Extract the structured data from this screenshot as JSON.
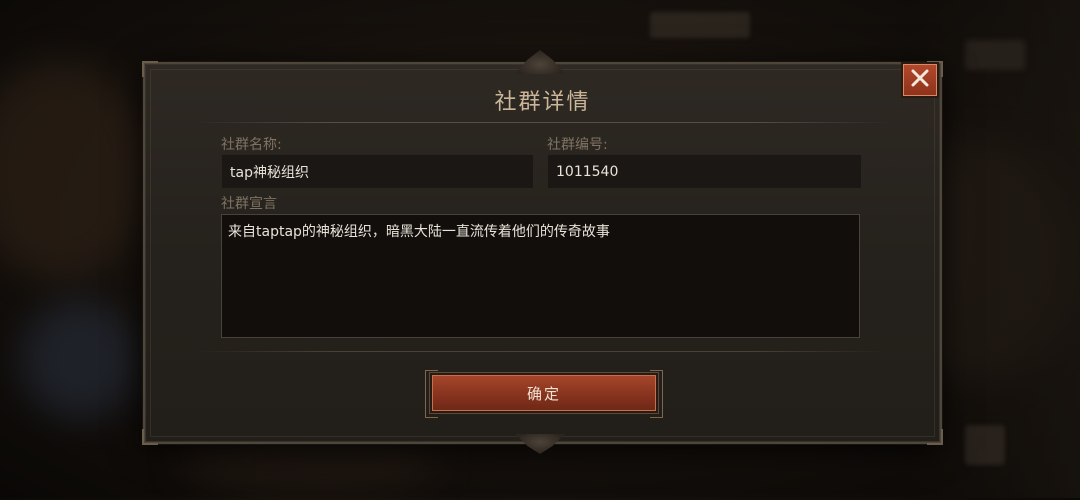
{
  "dialog": {
    "title": "社群详情",
    "name_label": "社群名称:",
    "name_value": "tap神秘组织",
    "id_label": "社群编号:",
    "id_value": "1011540",
    "declaration_label": "社群宣言",
    "declaration_text": "来自taptap的神秘组织，暗黑大陆一直流传着他们的传奇故事",
    "confirm_label": "确定"
  },
  "icons": {
    "close": "close-icon"
  },
  "colors": {
    "accent": "#9a3c24",
    "title": "#cbb699",
    "label": "#7f7363"
  }
}
